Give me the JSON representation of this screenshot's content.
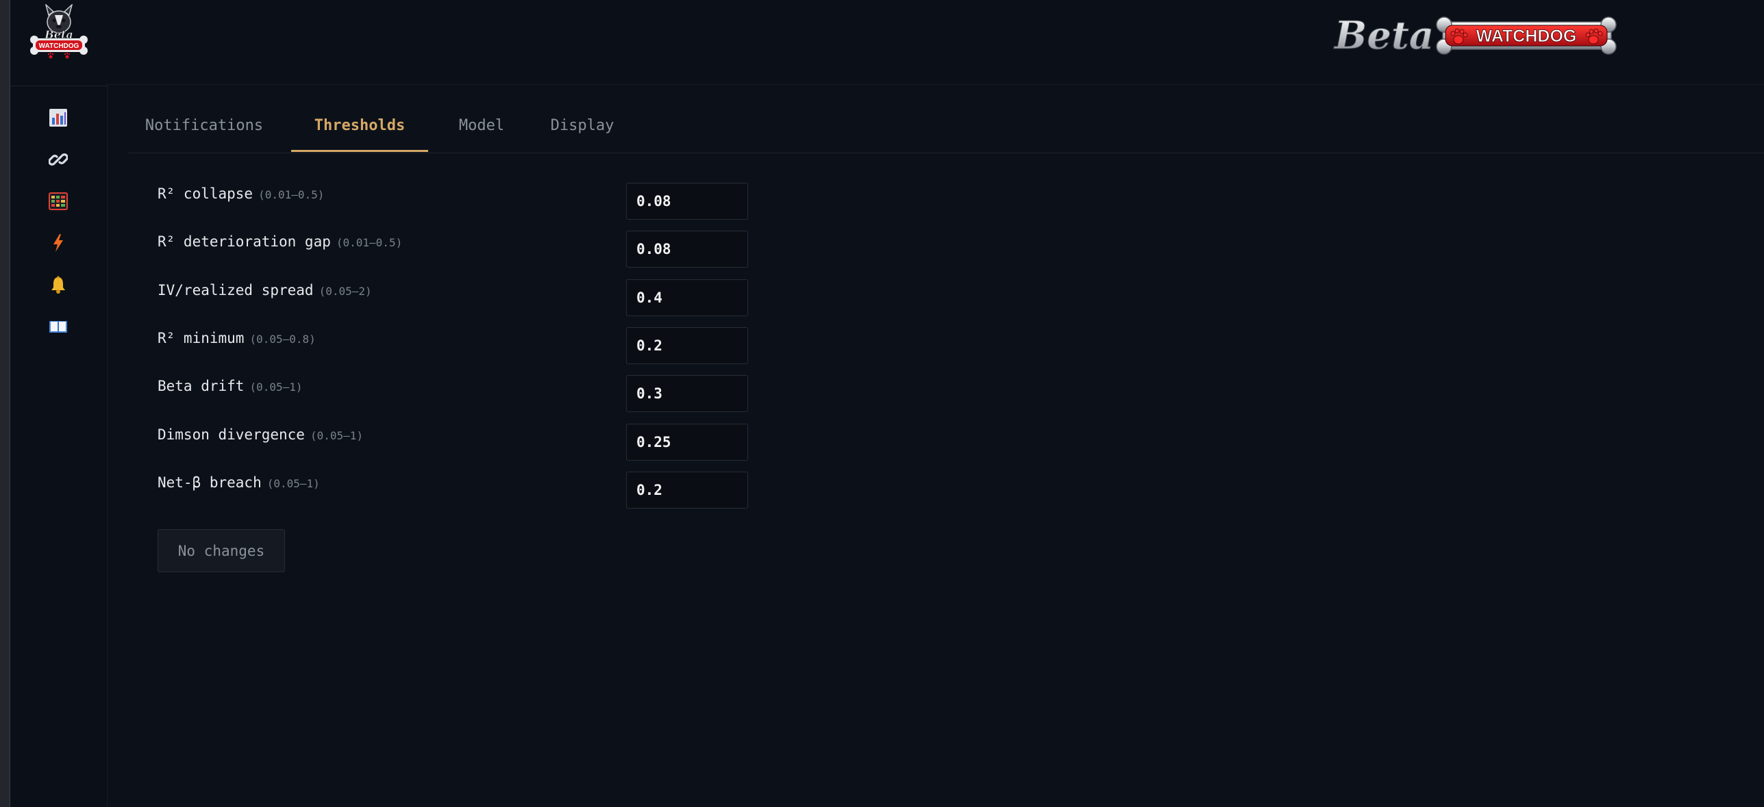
{
  "brand": {
    "script_text": "Beta",
    "badge_text": "WATCHDOG",
    "sidebar_logo_top": "Beta",
    "sidebar_logo_bottom": "WATCHDOG",
    "accent_red": "#d4141c",
    "accent_gold": "#d6a867"
  },
  "sidebar": {
    "items": [
      {
        "icon": "bar-chart-icon",
        "name": "dashboard"
      },
      {
        "icon": "link-icon",
        "name": "links"
      },
      {
        "icon": "grid-table-icon",
        "name": "grid"
      },
      {
        "icon": "lightning-icon",
        "name": "alerts-lightning"
      },
      {
        "icon": "bell-icon",
        "name": "notifications"
      },
      {
        "icon": "book-icon",
        "name": "docs"
      }
    ]
  },
  "tabs": [
    {
      "label": "Notifications",
      "active": false
    },
    {
      "label": "Thresholds",
      "active": true
    },
    {
      "label": "Model",
      "active": false
    },
    {
      "label": "Display",
      "active": false
    }
  ],
  "thresholds": [
    {
      "label": "R² collapse",
      "range": "(0.01–0.5)",
      "value": "0.08"
    },
    {
      "label": "R² deterioration gap",
      "range": "(0.01–0.5)",
      "value": "0.08"
    },
    {
      "label": "IV/realized spread",
      "range": "(0.05–2)",
      "value": "0.4"
    },
    {
      "label": "R² minimum",
      "range": "(0.05–0.8)",
      "value": "0.2"
    },
    {
      "label": "Beta drift",
      "range": "(0.05–1)",
      "value": "0.3"
    },
    {
      "label": "Dimson divergence",
      "range": "(0.05–1)",
      "value": "0.25"
    },
    {
      "label": "Net-β breach",
      "range": "(0.05–1)",
      "value": "0.2"
    }
  ],
  "save_button_label": "No changes"
}
